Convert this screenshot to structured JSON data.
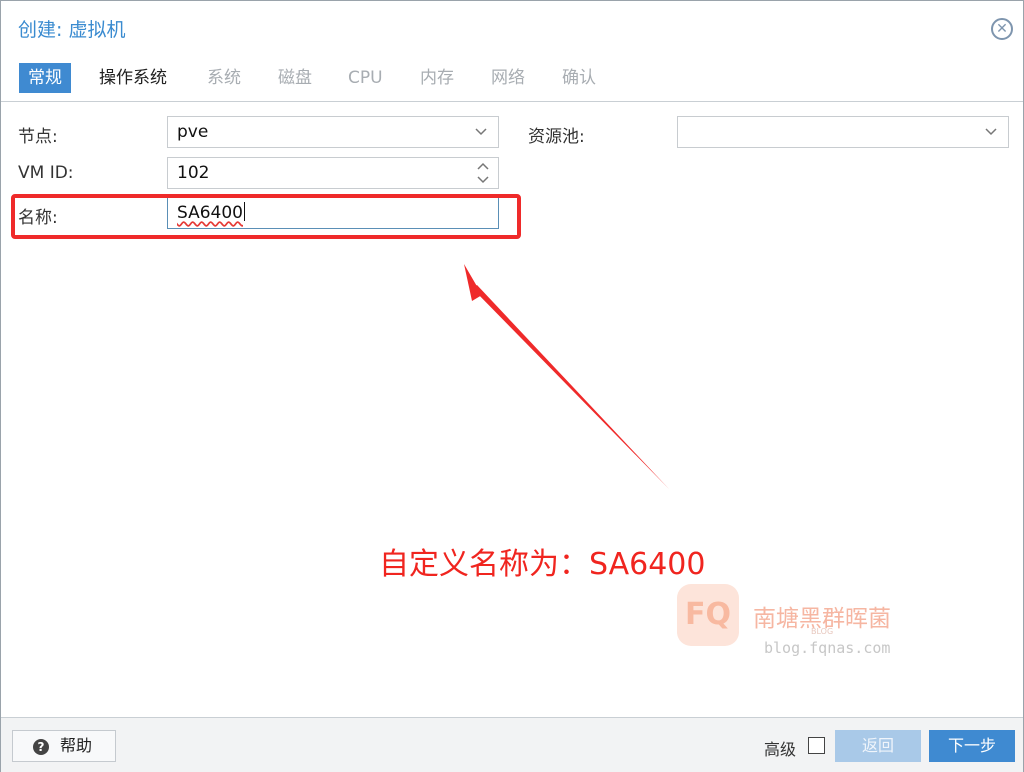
{
  "window": {
    "title": "创建: 虚拟机"
  },
  "tabs": [
    {
      "label": "常规",
      "state": "active"
    },
    {
      "label": "操作系统",
      "state": "enabled"
    },
    {
      "label": "系统",
      "state": "disabled"
    },
    {
      "label": "磁盘",
      "state": "disabled"
    },
    {
      "label": "CPU",
      "state": "disabled"
    },
    {
      "label": "内存",
      "state": "disabled"
    },
    {
      "label": "网络",
      "state": "disabled"
    },
    {
      "label": "确认",
      "state": "disabled"
    }
  ],
  "form": {
    "node": {
      "label": "节点:",
      "value": "pve"
    },
    "vmid": {
      "label": "VM ID:",
      "value": "102"
    },
    "name": {
      "label": "名称:",
      "value": "SA6400"
    },
    "pool": {
      "label": "资源池:",
      "value": ""
    }
  },
  "annotation": {
    "text": "自定义名称为：SA6400",
    "color": "#f0251f"
  },
  "watermark": {
    "logo": "FQ",
    "name": "南塘黑群晖菌",
    "sub": "BLOG",
    "url": "blog.fqnas.com"
  },
  "footer": {
    "help_label": "帮助",
    "advanced_label": "高级",
    "back_label": "返回",
    "next_label": "下一步"
  },
  "colors": {
    "accent": "#3f8ad1",
    "title": "#3a8bd0",
    "annotation": "#ef2a2a"
  },
  "icons": {
    "close": "close-circle-icon",
    "dropdown": "chevron-down-icon",
    "spinner": "spinner-updown-icon",
    "help": "question-circle-icon"
  }
}
